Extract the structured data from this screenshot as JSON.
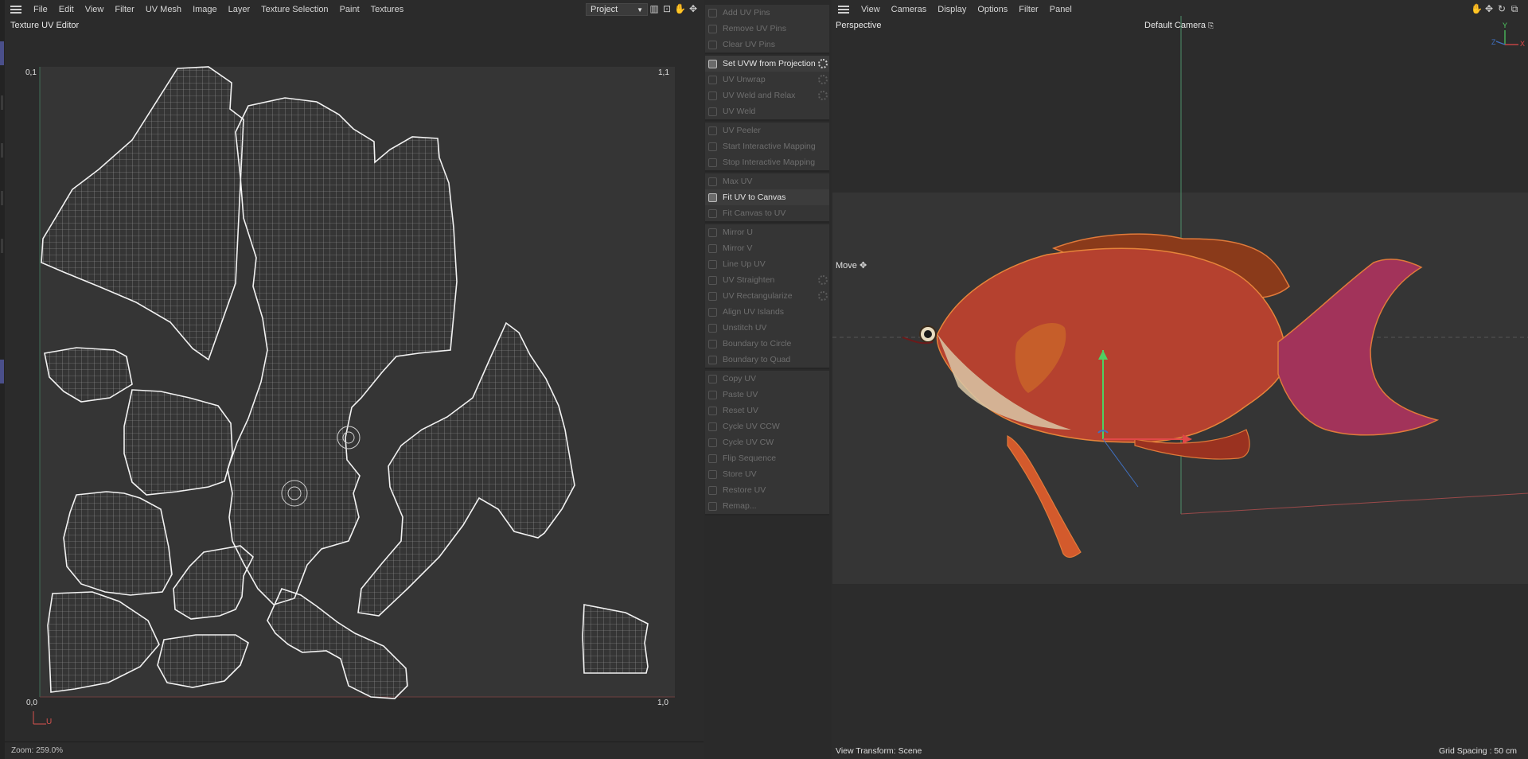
{
  "uv_editor": {
    "menu": [
      "File",
      "Edit",
      "View",
      "Filter",
      "UV Mesh",
      "Image",
      "Layer",
      "Texture Selection",
      "Paint",
      "Textures"
    ],
    "project_select": "Project",
    "title": "Texture UV Editor",
    "corners": {
      "top_left": "0,1",
      "top_right": "1,1",
      "bottom_left": "0,0",
      "bottom_right": "1,0"
    },
    "axis_u": "U",
    "status": "Zoom: 259.0%"
  },
  "commands": {
    "groups": [
      [
        {
          "label": "Add UV Pins",
          "active": false
        },
        {
          "label": "Remove UV Pins",
          "active": false
        },
        {
          "label": "Clear UV Pins",
          "active": false
        }
      ],
      [
        {
          "label": "Set UVW from Projection",
          "active": true,
          "gear": true
        },
        {
          "label": "UV Unwrap",
          "active": false,
          "gear": true
        },
        {
          "label": "UV Weld and Relax",
          "active": false,
          "gear": true
        },
        {
          "label": "UV Weld",
          "active": false
        }
      ],
      [
        {
          "label": "UV Peeler",
          "active": false
        },
        {
          "label": "Start Interactive Mapping",
          "active": false
        },
        {
          "label": "Stop Interactive Mapping",
          "active": false
        }
      ],
      [
        {
          "label": "Max UV",
          "active": false
        },
        {
          "label": "Fit UV to Canvas",
          "active": true
        },
        {
          "label": "Fit Canvas to UV",
          "active": false
        }
      ],
      [
        {
          "label": "Mirror U",
          "active": false
        },
        {
          "label": "Mirror V",
          "active": false
        },
        {
          "label": "Line Up UV",
          "active": false
        },
        {
          "label": "UV Straighten",
          "active": false,
          "gear": true
        },
        {
          "label": "UV Rectangularize",
          "active": false,
          "gear": true
        },
        {
          "label": "Align UV Islands",
          "active": false
        },
        {
          "label": "Unstitch UV",
          "active": false
        },
        {
          "label": "Boundary to Circle",
          "active": false
        },
        {
          "label": "Boundary to Quad",
          "active": false
        }
      ],
      [
        {
          "label": "Copy UV",
          "active": false
        },
        {
          "label": "Paste UV",
          "active": false
        },
        {
          "label": "Reset UV",
          "active": false
        },
        {
          "label": "Cycle UV CCW",
          "active": false
        },
        {
          "label": "Cycle UV CW",
          "active": false
        },
        {
          "label": "Flip Sequence",
          "active": false
        },
        {
          "label": "Store UV",
          "active": false
        },
        {
          "label": "Restore UV",
          "active": false
        },
        {
          "label": "Remap...",
          "active": false
        }
      ]
    ]
  },
  "viewport": {
    "menu": [
      "View",
      "Cameras",
      "Display",
      "Options",
      "Filter",
      "Panel"
    ],
    "label": "Perspective",
    "camera": "Default Camera",
    "tool": "Move",
    "view_transform": "View Transform: Scene",
    "grid_spacing": "Grid Spacing : 50 cm",
    "axis_x": "X",
    "axis_y": "Y",
    "axis_z": "Z"
  }
}
